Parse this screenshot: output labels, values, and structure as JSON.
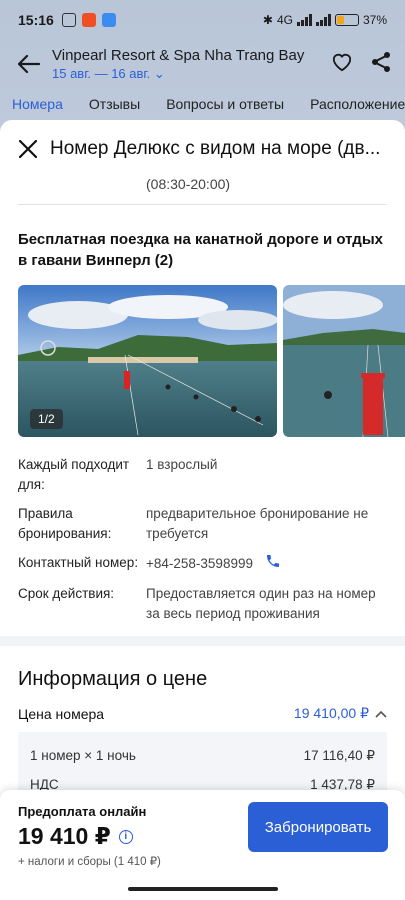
{
  "status_bar": {
    "time": "15:16",
    "battery": "37%",
    "network": "4G",
    "battery_level": 0.37
  },
  "hotel": {
    "name": "Vinpearl Resort & Spa Nha Trang Bay",
    "dates": "15 авг. — 16 авг."
  },
  "tabs": [
    "Номера",
    "Отзывы",
    "Вопросы и ответы",
    "Расположение"
  ],
  "sheet": {
    "title": "Номер Делюкс с видом на море (дв...",
    "hours_fragment": "(08:30-20:00)",
    "amenity_title": "Бесплатная поездка на канатной дороге и отдых в гавани Винперл (2)",
    "photo_counter": "1/2",
    "details": {
      "applies_to_label": "Каждый подходит для:",
      "applies_to_value": "1 взрослый",
      "booking_rules_label": "Правила бронирования:",
      "booking_rules_value": "предварительное бронирование не требуется",
      "contact_label": "Контактный номер:",
      "contact_value": "+84-258-3598999",
      "validity_label": "Срок действия:",
      "validity_value": "Предоставляется один раз на номер за весь период проживания"
    },
    "price_info": {
      "title": "Информация о цене",
      "room_price_label": "Цена номера",
      "room_price_value": "19 410,00 ₽",
      "breakdown": [
        {
          "label": "1 номер × 1 ночь",
          "value": "17 116,40 ₽"
        },
        {
          "label": "НДС",
          "value": "1 437,78 ₽"
        }
      ]
    }
  },
  "footer": {
    "prepay_label": "Предоплата онлайн",
    "total": "19 410 ₽",
    "taxes": "+ налоги и сборы (1 410 ₽)",
    "book_button": "Забронировать"
  },
  "colors": {
    "accent": "#2a5fd6"
  }
}
